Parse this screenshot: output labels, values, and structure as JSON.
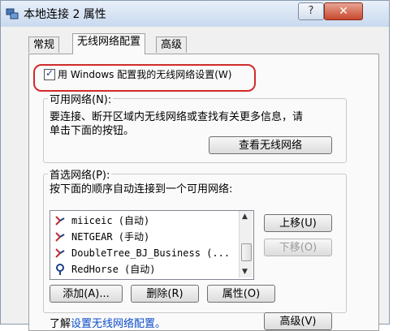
{
  "window": {
    "title": "本地连接 2 属性",
    "help_label": "?",
    "close_label": "✕"
  },
  "tabs": [
    {
      "label": "常规"
    },
    {
      "label": "无线网络配置"
    },
    {
      "label": "高级"
    }
  ],
  "checkbox": {
    "label": "用 Windows 配置我的无线网络设置(W)",
    "checked": true
  },
  "available_networks": {
    "title": "可用网络(N):",
    "description_line1": "要连接、断开区域内无线网络或查找有关更多信息，请",
    "description_line2": "单击下面的按钮。",
    "view_button": "查看无线网络"
  },
  "preferred_networks": {
    "title": "首选网络(P):",
    "description": "按下面的顺序自动连接到一个可用网络:",
    "items": [
      {
        "name": "miiceic (自动)",
        "icon": "wireless-auto-icon"
      },
      {
        "name": "NETGEAR (手动)",
        "icon": "wireless-manual-icon"
      },
      {
        "name": "DoubleTree_BJ_Business (...",
        "icon": "wireless-auto-icon"
      },
      {
        "name": "RedHorse (自动)",
        "icon": "wireless-connected-icon"
      }
    ],
    "move_up": "上移(U)",
    "move_down": "下移(O)",
    "add": "添加(A)...",
    "remove": "删除(R)",
    "properties": "属性(O)"
  },
  "footer": {
    "learn_prefix": "了解",
    "learn_link": "设置无线网络配置。",
    "advanced_button": "高级(V)"
  }
}
